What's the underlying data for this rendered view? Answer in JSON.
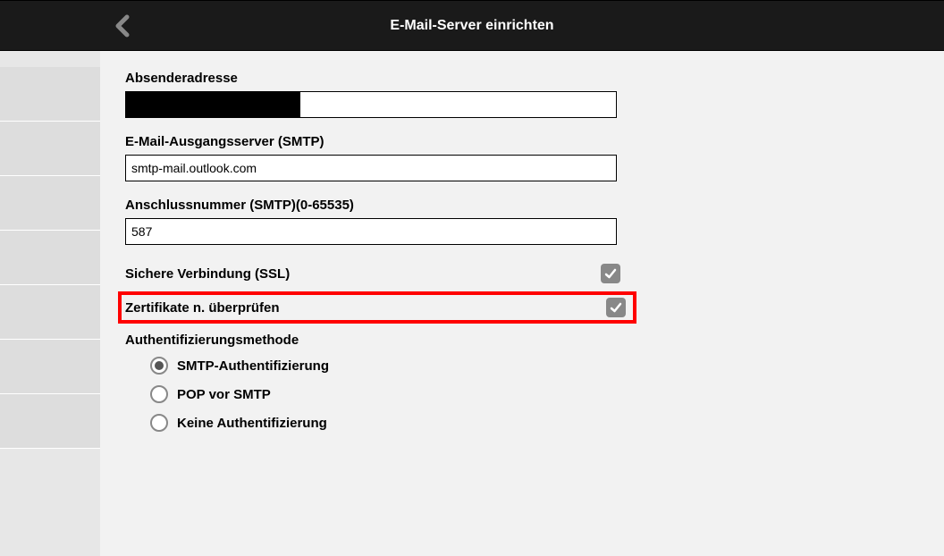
{
  "header": {
    "title": "E-Mail-Server einrichten"
  },
  "fields": {
    "sender_address": {
      "label": "Absenderadresse",
      "value": ""
    },
    "smtp_server": {
      "label": "E-Mail-Ausgangsserver (SMTP)",
      "value": "smtp-mail.outlook.com"
    },
    "port": {
      "label": "Anschlussnummer (SMTP)(0-65535)",
      "value": "587"
    },
    "ssl": {
      "label": "Sichere Verbindung (SSL)",
      "checked": true
    },
    "cert_no_verify": {
      "label": "Zertifikate n. überprüfen",
      "checked": true,
      "highlighted": true
    },
    "auth_method": {
      "label": "Authentifizierungsmethode",
      "options": [
        {
          "label": "SMTP-Authentifizierung",
          "selected": true
        },
        {
          "label": "POP vor SMTP",
          "selected": false
        },
        {
          "label": "Keine Authentifizierung",
          "selected": false
        }
      ]
    }
  }
}
